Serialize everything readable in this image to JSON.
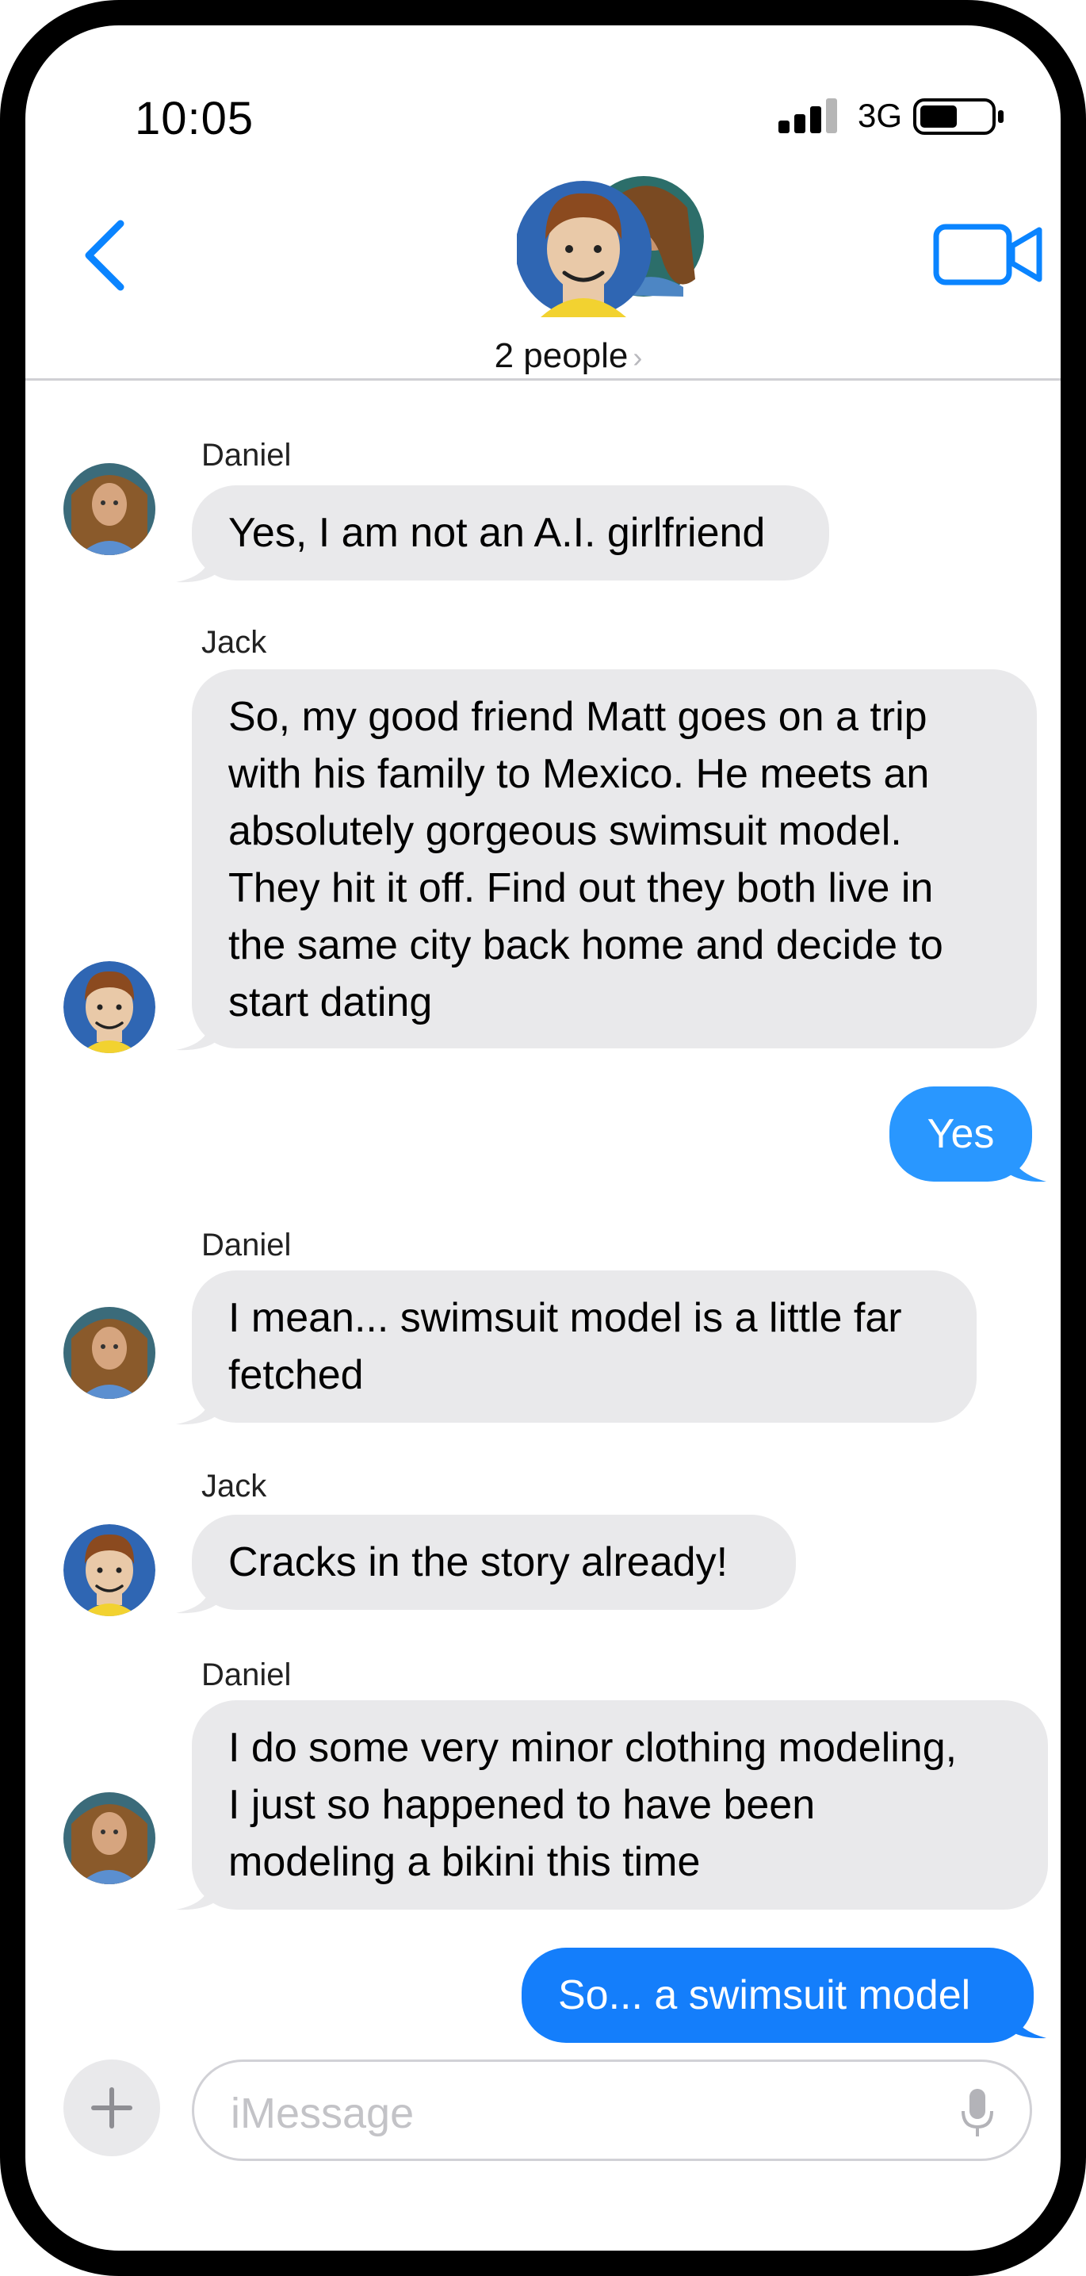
{
  "status_bar": {
    "time": "10:05",
    "network": "3G"
  },
  "header": {
    "group_label": "2 people"
  },
  "colors": {
    "accent": "#0a84ff",
    "sent_bubble": "#2997ff",
    "sent_bubble_dark": "#147efb",
    "received_bubble": "#e9e9eb"
  },
  "messages": [
    {
      "sender": "Daniel",
      "direction": "received",
      "text": "Yes, I am not an A.I. girlfriend"
    },
    {
      "sender": "Jack",
      "direction": "received",
      "lines": [
        "So, my good friend Matt goes on a trip",
        "with his family to Mexico.  He meets an",
        "absolutely gorgeous swimsuit model.",
        "They hit it off.  Find out they both live in",
        "the same city back home and decide to",
        "start dating"
      ]
    },
    {
      "direction": "sent",
      "text": "Yes"
    },
    {
      "sender": "Daniel",
      "direction": "received",
      "lines": [
        "I mean... swimsuit model is a little far",
        "fetched"
      ]
    },
    {
      "sender": "Jack",
      "direction": "received",
      "text": "Cracks in the story already!"
    },
    {
      "sender": "Daniel",
      "direction": "received",
      "lines": [
        "I do some very minor clothing modeling,",
        "I just so happened to have been",
        "modeling a bikini this time"
      ]
    },
    {
      "direction": "sent",
      "text": "So... a swimsuit model"
    }
  ],
  "composer": {
    "placeholder": "iMessage"
  },
  "icons": [
    "back-chevron-icon",
    "video-call-icon",
    "plus-icon",
    "microphone-icon",
    "signal-icon",
    "battery-icon"
  ]
}
